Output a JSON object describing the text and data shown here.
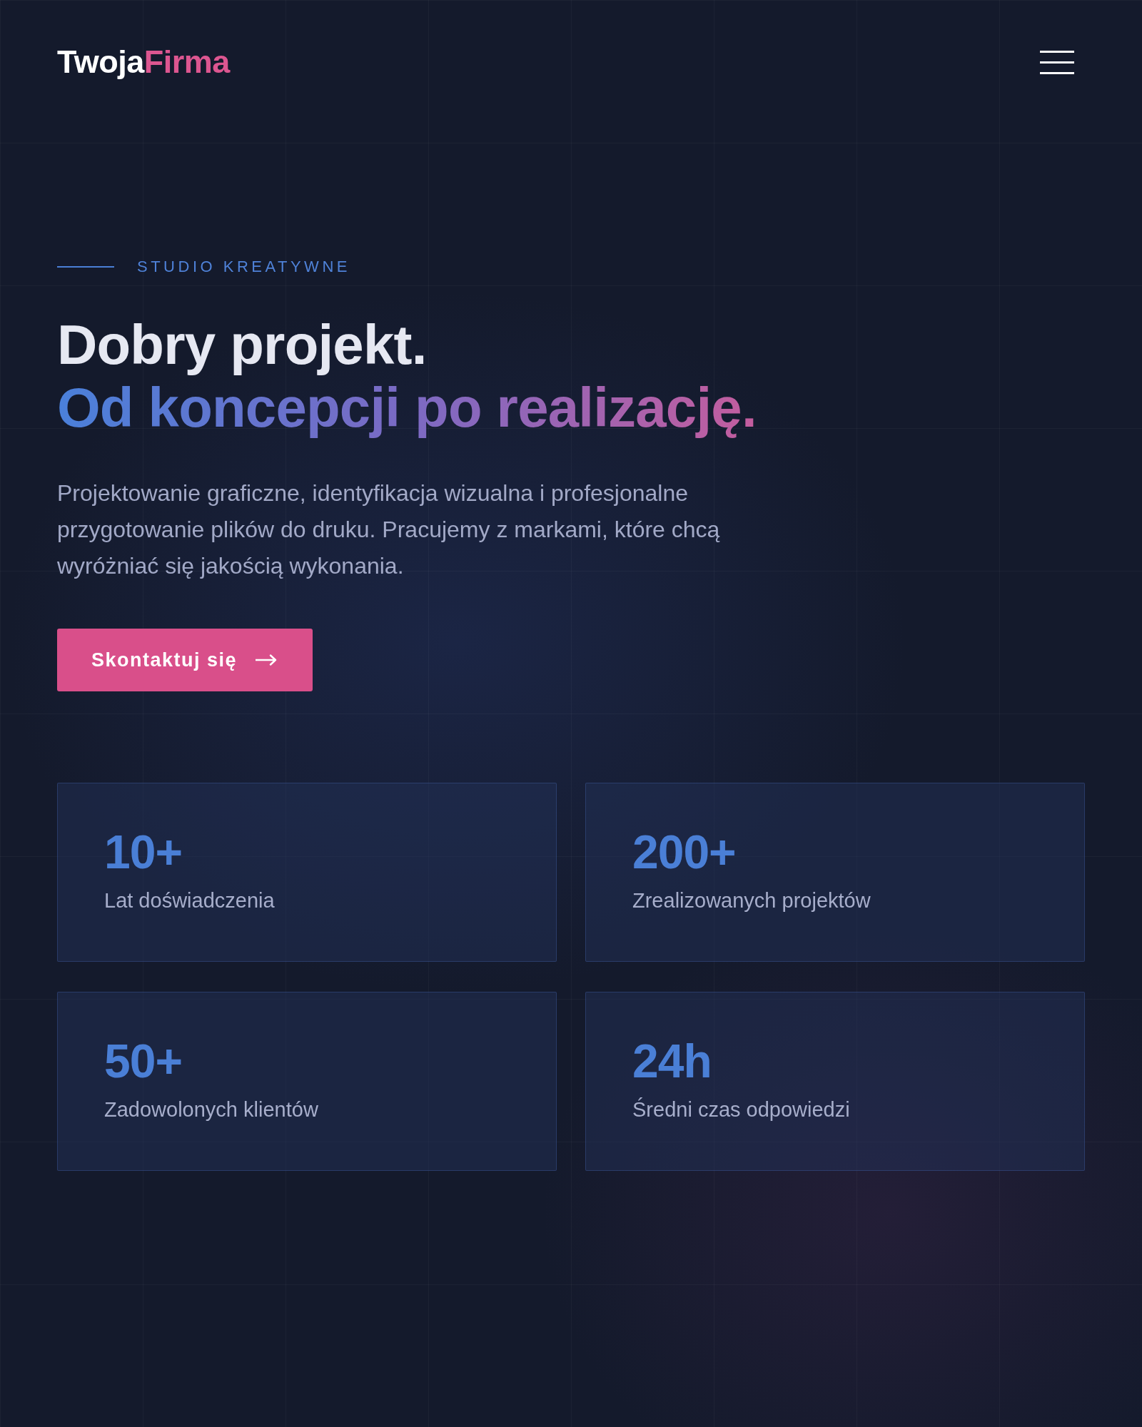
{
  "header": {
    "logo": {
      "primary": "Twoja",
      "accent": "Firma"
    }
  },
  "hero": {
    "eyebrow": "STUDIO KREATYWNE",
    "headline": "Dobry projekt.",
    "headline_accent": "Od koncepcji po realizację.",
    "description": "Projektowanie graficzne, identyfikacja wizualna i profesjonalne przygotowanie plików do druku. Pracujemy z markami, które chcą wyróżniać się jakością wykonania.",
    "cta": {
      "label": "Skontaktuj się"
    }
  },
  "stats": [
    {
      "value": "10+",
      "label": "Lat doświadczenia"
    },
    {
      "value": "200+",
      "label": "Zrealizowanych projektów"
    },
    {
      "value": "50+",
      "label": "Zadowolonych klientów"
    },
    {
      "value": "24h",
      "label": "Średni czas odpowiedzi"
    }
  ]
}
